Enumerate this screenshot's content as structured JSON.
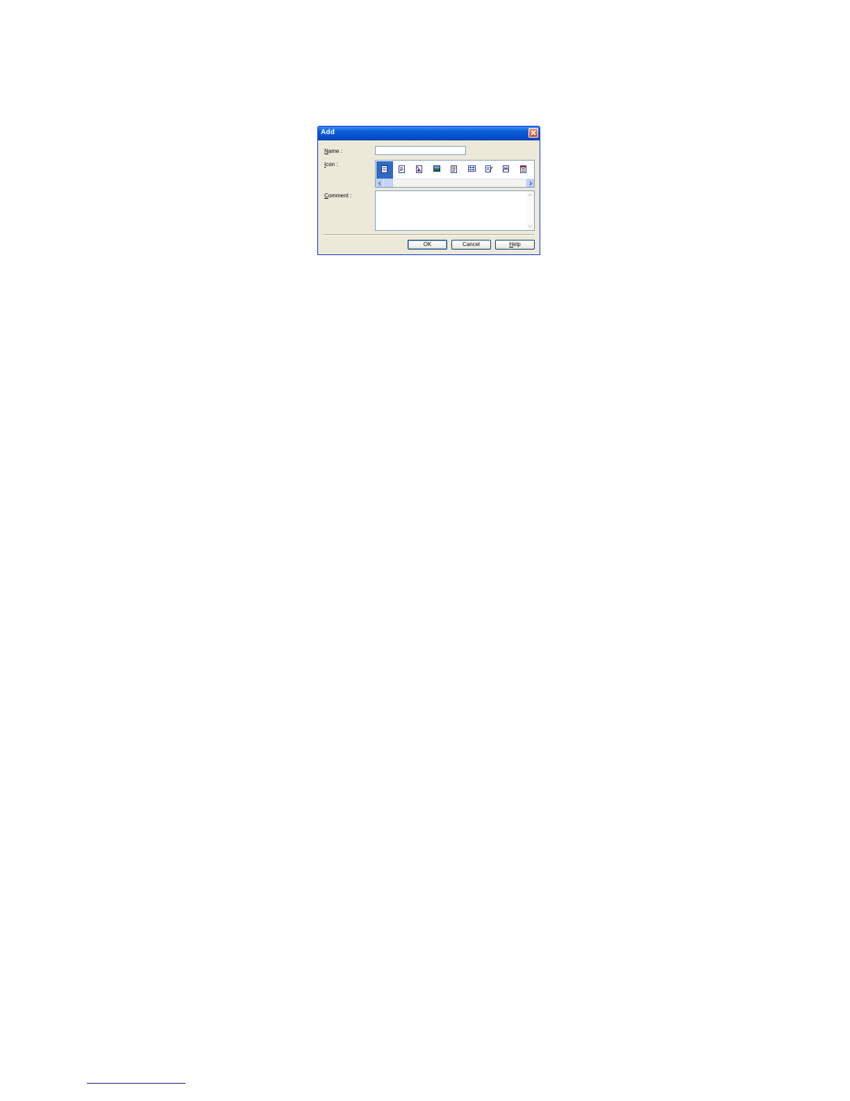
{
  "dialog": {
    "title": "Add",
    "name_label_accel": "N",
    "name_label_rest": "ame :",
    "name_value": "",
    "icon_label_accel": "I",
    "icon_label_rest": "con :",
    "comment_label_accel": "C",
    "comment_label_rest": "omment :",
    "comment_value": "",
    "icons": [
      {
        "name": "document-icon",
        "selected": true
      },
      {
        "name": "text-document-icon",
        "selected": false
      },
      {
        "name": "red-document-icon",
        "selected": false
      },
      {
        "name": "image-icon",
        "selected": false
      },
      {
        "name": "list-document-icon",
        "selected": false
      },
      {
        "name": "grid-document-icon",
        "selected": false
      },
      {
        "name": "pencil-document-icon",
        "selected": false
      },
      {
        "name": "signature-icon",
        "selected": false
      },
      {
        "name": "calendar-icon",
        "selected": false
      }
    ],
    "buttons": {
      "ok": "OK",
      "cancel": "Cancel",
      "help_accel": "H",
      "help_rest": "elp"
    }
  },
  "colors": {
    "titlebar": "#0a5fd8",
    "dialog_bg": "#ece9d8",
    "selection": "#316ac5",
    "close_button": "#d3471f"
  }
}
